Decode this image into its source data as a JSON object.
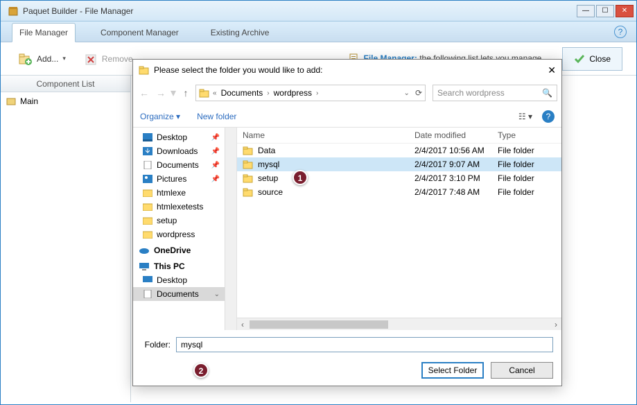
{
  "app": {
    "title": "Paquet Builder - File Manager",
    "tabs": [
      "File Manager",
      "Component Manager",
      "Existing Archive"
    ],
    "activeTab": 0
  },
  "ribbon": {
    "add_label": "Add...",
    "remove_label": "Remove",
    "info_link": "File Manager:",
    "info_text": "the following list lets you manage",
    "close_label": "Close"
  },
  "sidebar": {
    "header": "Component List",
    "items": [
      "Main"
    ]
  },
  "dialog": {
    "title": "Please select the folder you would like to add:",
    "breadcrumbs": [
      "Documents",
      "wordpress"
    ],
    "search_placeholder": "Search wordpress",
    "organize_label": "Organize",
    "newfolder_label": "New folder",
    "tree": {
      "quick": [
        {
          "label": "Desktop",
          "pin": true
        },
        {
          "label": "Downloads",
          "pin": true
        },
        {
          "label": "Documents",
          "pin": true
        },
        {
          "label": "Pictures",
          "pin": true
        },
        {
          "label": "htmlexe",
          "pin": false
        },
        {
          "label": "htmlexetests",
          "pin": false
        },
        {
          "label": "setup",
          "pin": false
        },
        {
          "label": "wordpress",
          "pin": false
        }
      ],
      "onedrive": "OneDrive",
      "thispc": "This PC",
      "pc_children": [
        {
          "label": "Desktop",
          "selected": false
        },
        {
          "label": "Documents",
          "selected": true
        }
      ]
    },
    "columns": {
      "name": "Name",
      "date": "Date modified",
      "type": "Type"
    },
    "rows": [
      {
        "name": "Data",
        "date": "2/4/2017 10:56 AM",
        "type": "File folder",
        "selected": false
      },
      {
        "name": "mysql",
        "date": "2/4/2017 9:07 AM",
        "type": "File folder",
        "selected": true
      },
      {
        "name": "setup",
        "date": "2/4/2017 3:10 PM",
        "type": "File folder",
        "selected": false
      },
      {
        "name": "source",
        "date": "2/4/2017 7:48 AM",
        "type": "File folder",
        "selected": false
      }
    ],
    "folder_label": "Folder:",
    "folder_value": "mysql",
    "select_label": "Select Folder",
    "cancel_label": "Cancel"
  },
  "callouts": {
    "c1": "1",
    "c2": "2"
  }
}
